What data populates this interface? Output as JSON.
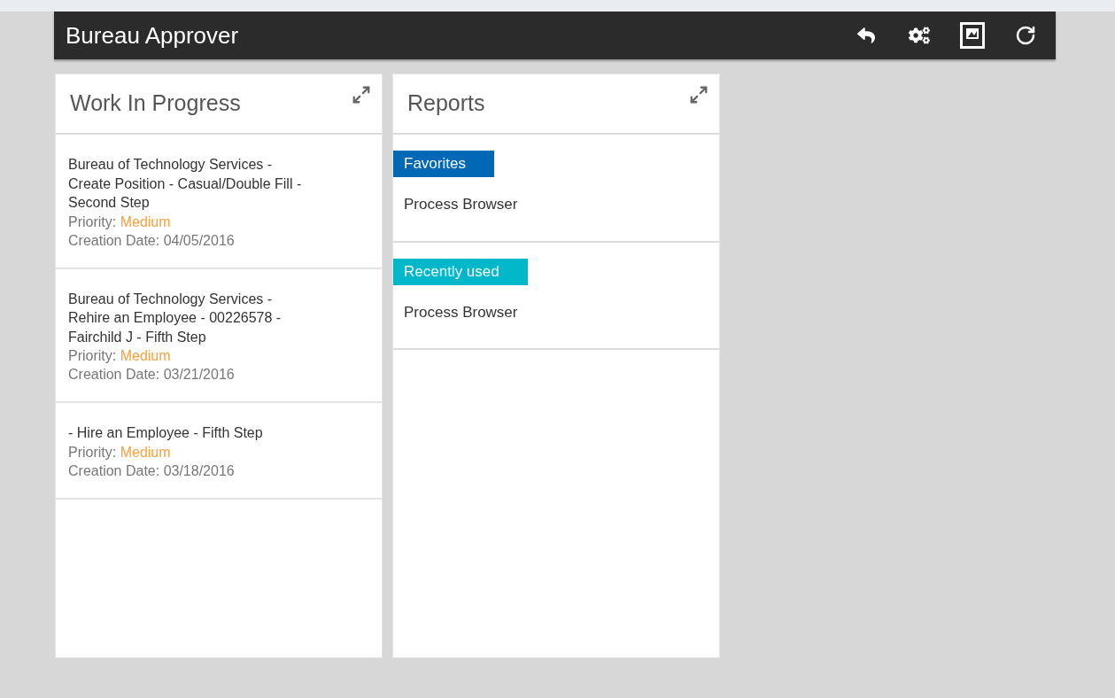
{
  "header": {
    "title": "Bureau Approver",
    "actions": [
      {
        "kind": "reply"
      },
      {
        "kind": "gears"
      },
      {
        "kind": "picture"
      },
      {
        "kind": "refresh"
      }
    ]
  },
  "panels": [
    {
      "kind": "tasks",
      "title": "Work In Progress",
      "tasks": [
        {
          "title": "Bureau of Technology Services - Create Position - Casual/Double Fill - Second Step",
          "priority_label": "Priority:",
          "priority": "Medium",
          "date_label": "Creation Date:",
          "date": "04/05/2016"
        },
        {
          "title": "Bureau of Technology Services - Rehire an Employee - 00226578 - Fairchild J - Fifth Step",
          "priority_label": "Priority:",
          "priority": "Medium",
          "date_label": "Creation Date:",
          "date": "03/21/2016"
        },
        {
          "title": "- Hire an Employee - Fifth Step",
          "priority_label": "Priority:",
          "priority": "Medium",
          "date_label": "Creation Date:",
          "date": "03/18/2016"
        }
      ]
    },
    {
      "kind": "reports",
      "title": "Reports",
      "sections": [
        {
          "tag": "Favorites",
          "color": "#0068b4",
          "items": [
            "Process Browser"
          ]
        },
        {
          "tag": "Recently used",
          "color": "#00b8c9",
          "items": [
            "Process Browser"
          ]
        }
      ]
    }
  ]
}
